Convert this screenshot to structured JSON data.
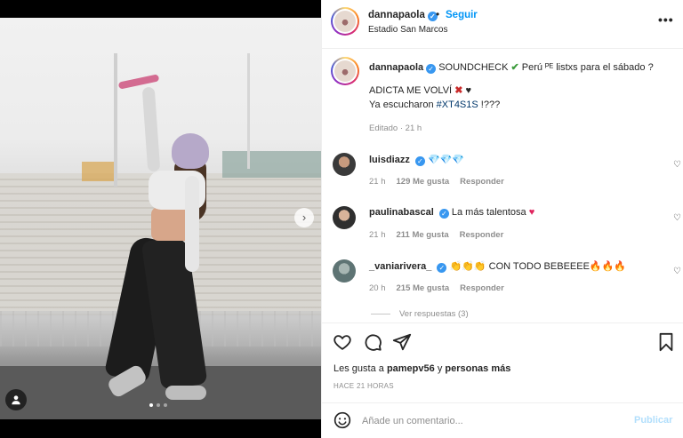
{
  "post": {
    "username": "dannapaola",
    "follow_label": "Seguir",
    "dot_separator": "•",
    "location": "Estadio San Marcos",
    "more_label": "•••"
  },
  "caption": {
    "username": "dannapaola",
    "line1": "SOUNDCHECK",
    "check_glyph": "✔",
    "line1_rest": "Perú ᴾᴱ listxs para el sábado ?",
    "line2": "ADICTA ME VOLVÍ",
    "cross_glyph": "✖",
    "heart_glyph": "♥",
    "line3_pre": "Ya escucharon",
    "hashtag": "#XT4S1S",
    "line3_post": "!???",
    "edited": "Editado · 21 h"
  },
  "comments": [
    {
      "username": "luisdiazz",
      "text": "💎💎💎",
      "time": "21 h",
      "likes": "129 Me gusta",
      "reply": "Responder"
    },
    {
      "username": "paulinabascal",
      "text": "La más talentosa",
      "emoji": "♥",
      "time": "21 h",
      "likes": "211 Me gusta",
      "reply": "Responder"
    },
    {
      "username": "_vaniarivera_",
      "text_pre": "👏👏👏",
      "text": "CON TODO BEBEEEE",
      "emoji": "🔥🔥🔥",
      "time": "20 h",
      "likes": "215 Me gusta",
      "reply": "Responder"
    }
  ],
  "replies_label": "Ver respuestas (3)",
  "likes": {
    "prefix": "Les gusta a",
    "user": "pamepv56",
    "joiner": "y",
    "others": "personas más"
  },
  "time_ago": "HACE 21 HORAS",
  "add_comment": {
    "placeholder": "Añade un comentario...",
    "publish_label": "Publicar"
  },
  "colors": {
    "link": "#0095f6",
    "verified": "#3897f0",
    "muted": "#8e8e8e",
    "publish_disabled": "#b2dffc"
  }
}
